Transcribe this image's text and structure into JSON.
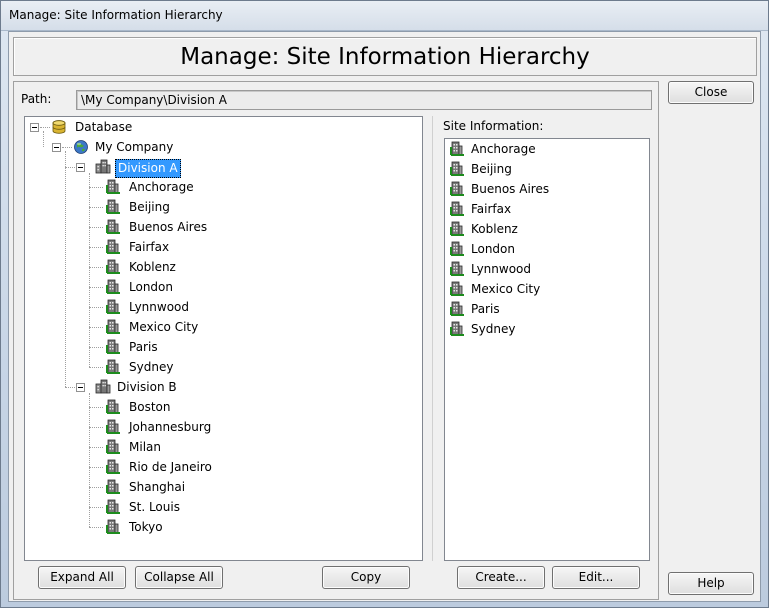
{
  "window": {
    "title": "Manage: Site Information Hierarchy"
  },
  "header": {
    "title": "Manage: Site Information Hierarchy"
  },
  "path": {
    "label": "Path:",
    "value": "\\My Company\\Division A"
  },
  "tree": {
    "root": "Database",
    "company": "My Company",
    "division_a": {
      "label": "Division A",
      "sites": [
        "Anchorage",
        "Beijing",
        "Buenos Aires",
        "Fairfax",
        "Koblenz",
        "London",
        "Lynnwood",
        "Mexico City",
        "Paris",
        "Sydney"
      ]
    },
    "division_b": {
      "label": "Division B",
      "sites": [
        "Boston",
        "Johannesburg",
        "Milan",
        "Rio de Janeiro",
        "Shanghai",
        "St. Louis",
        "Tokyo"
      ]
    }
  },
  "site_info": {
    "label": "Site Information:",
    "items": [
      "Anchorage",
      "Beijing",
      "Buenos Aires",
      "Fairfax",
      "Koblenz",
      "London",
      "Lynnwood",
      "Mexico City",
      "Paris",
      "Sydney"
    ]
  },
  "buttons": {
    "close": "Close",
    "help": "Help",
    "expand_all": "Expand All",
    "collapse_all": "Collapse All",
    "copy": "Copy",
    "create": "Create...",
    "edit": "Edit..."
  },
  "colors": {
    "selection": "#3399ff",
    "site_icon_accent": "#1e8c1e"
  }
}
